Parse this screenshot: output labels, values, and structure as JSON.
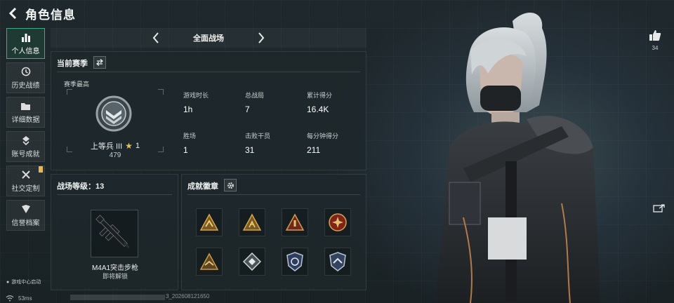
{
  "header": {
    "title": "角色信息",
    "back_icon": "chevron-left-icon"
  },
  "sidebar": {
    "items": [
      {
        "label": "个人信息",
        "icon": "bar-chart-icon",
        "active": true
      },
      {
        "label": "历史战绩",
        "icon": "history-clock-icon",
        "active": false
      },
      {
        "label": "详细数据",
        "icon": "folder-icon",
        "active": false
      },
      {
        "label": "账号成就",
        "icon": "achievement-badge-icon",
        "active": false
      },
      {
        "label": "社交定制",
        "icon": "tools-icon",
        "active": false,
        "notice": true
      },
      {
        "label": "信誉档案",
        "icon": "shield-icon",
        "active": false
      }
    ],
    "game_center_login": "游戏中心启动"
  },
  "mode": {
    "label": "全面战场"
  },
  "season": {
    "title": "当前赛季",
    "best_label": "赛季最高",
    "rank_name": "上等兵 III",
    "rank_stars": "1",
    "rank_points": "479",
    "stats": [
      {
        "key": "游戏时长",
        "value": "1h"
      },
      {
        "key": "总战局",
        "value": "7"
      },
      {
        "key": "累计得分",
        "value": "16.4K"
      },
      {
        "key": "胜场",
        "value": "1"
      },
      {
        "key": "击败干员",
        "value": "31"
      },
      {
        "key": "每分钟得分",
        "value": "211"
      }
    ]
  },
  "battlefield_level": {
    "title": "战场等级：13",
    "weapon_name": "M4A1突击步枪",
    "weapon_status": "即将解锁"
  },
  "achievements": {
    "title": "成就徽章",
    "badges": [
      {
        "icon": "gold-triangle-badge-icon"
      },
      {
        "icon": "gold-triangle-badge-icon"
      },
      {
        "icon": "red-triangle-badge-icon"
      },
      {
        "icon": "red-emblem-badge-icon"
      },
      {
        "icon": "gold-triangle-badge-icon"
      },
      {
        "icon": "diamond-badge-icon"
      },
      {
        "icon": "blue-shield-badge-icon"
      },
      {
        "icon": "blue-shield-badge-icon"
      }
    ]
  },
  "social": {
    "likes": "34"
  },
  "footer": {
    "latency": "53ms",
    "uid": "3_202608121650"
  },
  "colors": {
    "accent": "#3fa98a",
    "gold": "#e7c24d",
    "notice": "#e5b94c"
  }
}
